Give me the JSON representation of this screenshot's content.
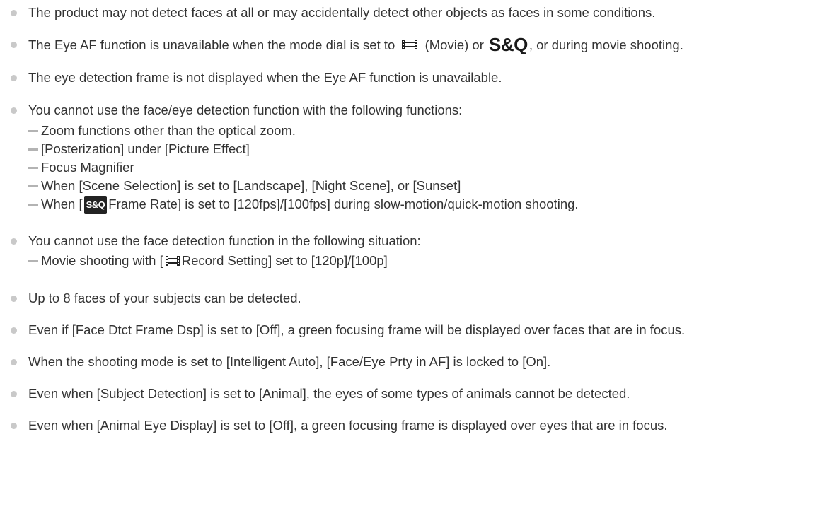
{
  "notes": {
    "n1": "The product may not detect faces at all or may accidentally detect other objects as faces in some conditions.",
    "n2": {
      "before": "The Eye AF function is unavailable when the mode dial is set to",
      "movie_label": "(Movie) or",
      "sq": "S&Q",
      "after": ", or during movie shooting."
    },
    "n3": "The eye detection frame is not displayed when the Eye AF function is unavailable.",
    "n4": {
      "intro": "You cannot use the face/eye detection function with the following functions:",
      "s1": "Zoom functions other than the optical zoom.",
      "s2": "[Posterization] under [Picture Effect]",
      "s3": "Focus Magnifier",
      "s4": "When [Scene Selection] is set to [Landscape], [Night Scene], or [Sunset]",
      "s5_before": "When [",
      "s5_badge": "S&Q",
      "s5_after": "Frame Rate] is set to [120fps]/[100fps] during slow-motion/quick-motion shooting."
    },
    "n5": {
      "intro": "You cannot use the face detection function in the following situation:",
      "s1_before": "Movie shooting with [",
      "s1_after": "Record Setting] set to [120p]/[100p]"
    },
    "n6": "Up to 8 faces of your subjects can be detected.",
    "n7": "Even if [Face Dtct Frame Dsp] is set to [Off], a green focusing frame will be displayed over faces that are in focus.",
    "n8": "When the shooting mode is set to [Intelligent Auto], [Face/Eye Prty in AF] is locked to [On].",
    "n9": "Even when [Subject Detection] is set to [Animal], the eyes of some types of animals cannot be detected.",
    "n10": "Even when [Animal Eye Display] is set to [Off], a green focusing frame is displayed over eyes that are in focus."
  },
  "icons": {
    "bullet": "bullet-dot",
    "movie": "movie-film-icon"
  },
  "colors": {
    "text": "#333333",
    "bullet": "#c9c9c9",
    "dash": "#b3b3b3"
  }
}
